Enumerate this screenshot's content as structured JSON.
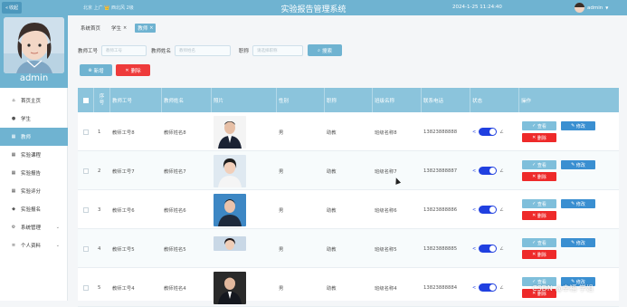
{
  "topbar": {
    "collapse_label": "收起",
    "weather": "北京 上广 👑 西北风 2级",
    "app_title": "实验报告管理系统",
    "datetime": "2024-1-25 11:24:40",
    "user_name": "admin"
  },
  "sidebar": {
    "profile_name": "admin",
    "items": [
      {
        "label": "首页主页",
        "icon": "home-icon",
        "active": false
      },
      {
        "label": "学生",
        "icon": "user-icon",
        "active": false
      },
      {
        "label": "教师",
        "icon": "grid-icon",
        "active": true
      },
      {
        "label": "实验课程",
        "icon": "grid-icon",
        "active": false
      },
      {
        "label": "实验报告",
        "icon": "grid-icon",
        "active": false
      },
      {
        "label": "实验评分",
        "icon": "grid-icon",
        "active": false
      },
      {
        "label": "实验报名",
        "icon": "pin-icon",
        "active": false
      },
      {
        "label": "系统管理",
        "icon": "gear-icon",
        "active": false,
        "expandable": true
      },
      {
        "label": "个人资料",
        "icon": "list-icon",
        "active": false,
        "expandable": true
      }
    ]
  },
  "tabs": [
    {
      "label": "系统首页",
      "closable": false,
      "active": false
    },
    {
      "label": "学生",
      "closable": true,
      "active": false
    },
    {
      "label": "教师",
      "closable": true,
      "active": true
    }
  ],
  "filters": {
    "teacher_id_label": "教师工号",
    "teacher_id_placeholder": "教师工号",
    "teacher_name_label": "教师姓名",
    "teacher_name_placeholder": "教师姓名",
    "title_label": "职称",
    "title_placeholder": "请选择职称",
    "search_label": "搜索"
  },
  "actions": {
    "add_label": "新增",
    "delete_label": "删除"
  },
  "table": {
    "headers": {
      "index": "序号",
      "teacher_id": "教师工号",
      "teacher_name": "教师姓名",
      "photo": "照片",
      "gender": "性别",
      "title": "职称",
      "class_name": "班级名称",
      "phone": "联系电话",
      "status": "状态",
      "ops": "操作"
    },
    "ops": {
      "view": "查看",
      "edit": "修改",
      "delete": "删除"
    },
    "rows": [
      {
        "index": "1",
        "teacher_id": "教师工号8",
        "teacher_name": "教师姓名8",
        "gender": "男",
        "title": "助教",
        "class_name": "班级名称8",
        "phone": "13823888888",
        "status_on": true
      },
      {
        "index": "2",
        "teacher_id": "教师工号7",
        "teacher_name": "教师姓名7",
        "gender": "男",
        "title": "助教",
        "class_name": "班级名称7",
        "phone": "13823888887",
        "status_on": true
      },
      {
        "index": "3",
        "teacher_id": "教师工号6",
        "teacher_name": "教师姓名6",
        "gender": "男",
        "title": "助教",
        "class_name": "班级名称6",
        "phone": "13823888886",
        "status_on": true
      },
      {
        "index": "4",
        "teacher_id": "教师工号5",
        "teacher_name": "教师姓名5",
        "gender": "男",
        "title": "助教",
        "class_name": "班级名称5",
        "phone": "13823888885",
        "status_on": true
      },
      {
        "index": "5",
        "teacher_id": "教师工号4",
        "teacher_name": "教师姓名4",
        "gender": "男",
        "title": "助教",
        "class_name": "班级名称4",
        "phone": "13823888884",
        "status_on": true
      }
    ]
  },
  "watermark": "CSDN @幸福·学姐",
  "colors": {
    "primary": "#6fb3d1",
    "header": "#8bc4dc",
    "danger": "#ee3b3b",
    "toggle": "#2040e0"
  }
}
